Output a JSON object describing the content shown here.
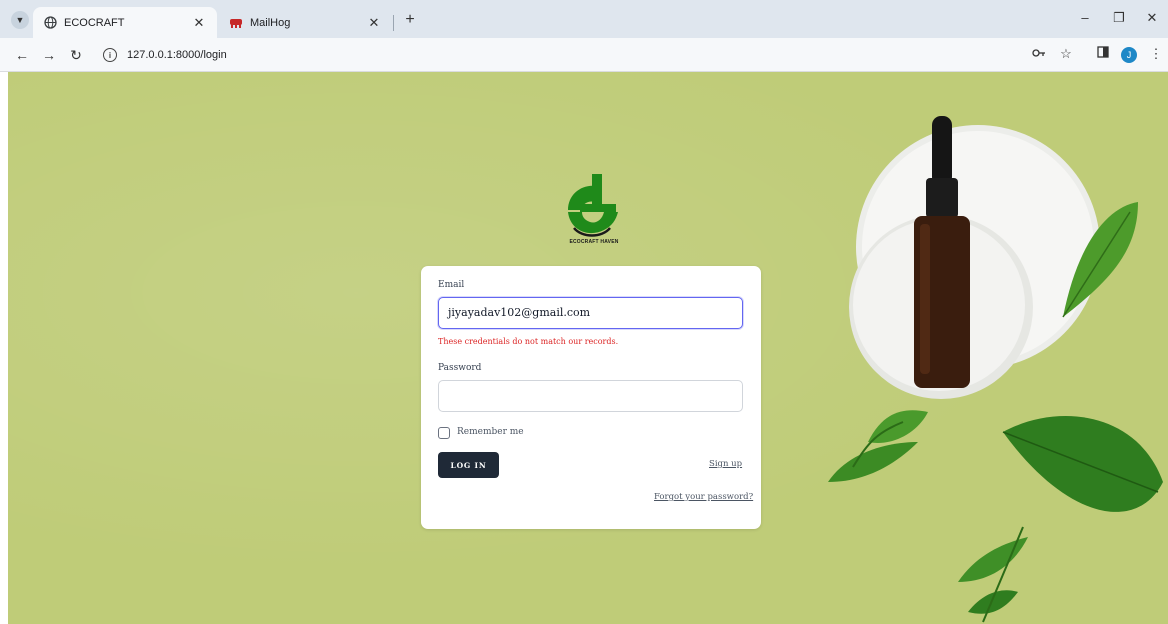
{
  "browser": {
    "tabs": [
      {
        "title": "ECOCRAFT",
        "active": true,
        "favicon": "globe-icon"
      },
      {
        "title": "MailHog",
        "active": false,
        "favicon": "mailhog-pig-icon"
      }
    ],
    "url": "127.0.0.1:8000/login",
    "profile_initial": "J",
    "accent": "#1e88c7"
  },
  "page": {
    "background": "#bfcc78",
    "brand": "ECOCRAFT HAVEN",
    "logo_color": "#1f8a1a"
  },
  "login": {
    "email_label": "Email",
    "email_value": "jiyayadav102@gmail.com",
    "error_message": "These credentials do not match our records.",
    "password_label": "Password",
    "password_value": "",
    "remember_label": "Remember me",
    "remember_checked": false,
    "login_button": "LOG IN",
    "signup_link": "Sign up",
    "forgot_link": "Forgot your password?"
  }
}
